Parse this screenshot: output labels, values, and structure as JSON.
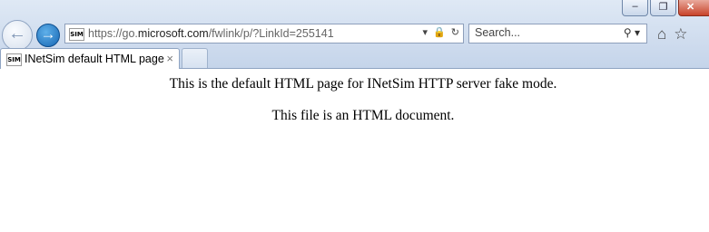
{
  "window": {
    "minimize_glyph": "–",
    "maximize_glyph": "❐",
    "close_glyph": "✕"
  },
  "nav": {
    "back_glyph": "←",
    "forward_glyph": "→",
    "favicon_text": "SIM",
    "url_prefix": "https://go.",
    "url_domain": "microsoft.com",
    "url_path": "/fwlink/p/?LinkId=255141",
    "url_icons": [
      "▾",
      "🔒",
      "↻"
    ]
  },
  "search": {
    "placeholder": "Search...",
    "icon": "⚲",
    "dropdown": "▾"
  },
  "toolbar": {
    "home_icon": "⌂",
    "favorites_icon": "☆"
  },
  "tabs": [
    {
      "favicon_text": "SIM",
      "title": "INetSim default HTML page",
      "close_glyph": "×"
    }
  ],
  "page": {
    "line1": "This is the default HTML page for INetSim HTTP server fake mode.",
    "line2": "This file is an HTML document."
  }
}
